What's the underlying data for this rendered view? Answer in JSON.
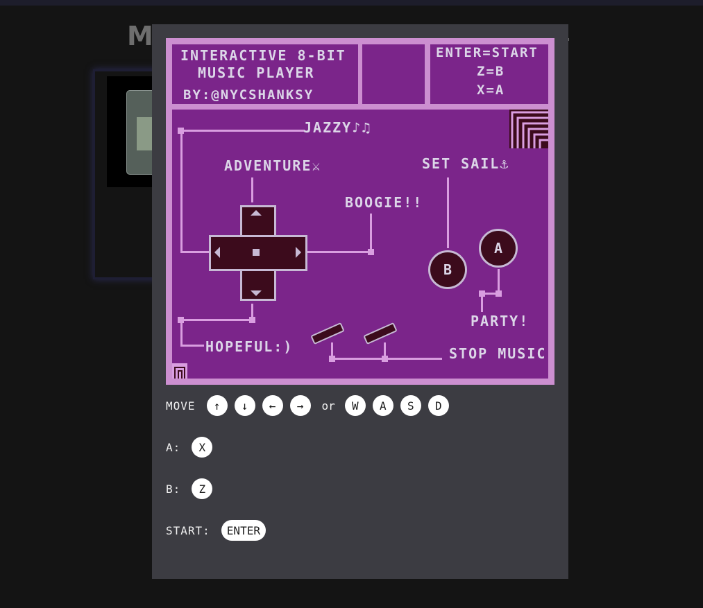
{
  "background": {
    "title": "M"
  },
  "card": {
    "title_line1": "INTERACTIVE 8-BIT",
    "title_line2": "MUSIC PLAYER",
    "byline": "BY:@NYCSHANKSY",
    "hints": [
      "ENTER=START",
      "Z=B",
      "X=A"
    ]
  },
  "songs": {
    "jazzy": "JAZZY♪♫",
    "adventure": "ADVENTURE⚔",
    "boogie": "BOOGIE!!",
    "set_sail": "SET SAIL⚓",
    "party": "PARTY!",
    "hopeful": "HOPEFUL:)",
    "stop": "STOP MUSIC"
  },
  "buttons": {
    "a": "A",
    "b": "B"
  },
  "controls": {
    "move_label": "MOVE",
    "arrows": [
      "↑",
      "↓",
      "←",
      "→"
    ],
    "or": "or",
    "wasd": [
      "W",
      "A",
      "S",
      "D"
    ],
    "a_label": "A:",
    "a_key": "X",
    "b_label": "B:",
    "b_key": "Z",
    "start_label": "START:",
    "start_key": "ENTER"
  },
  "colors": {
    "card_border": "#cc8fd0",
    "panel": "#7b258a",
    "button": "#3c0b1c",
    "modal": "#3c3c42"
  }
}
